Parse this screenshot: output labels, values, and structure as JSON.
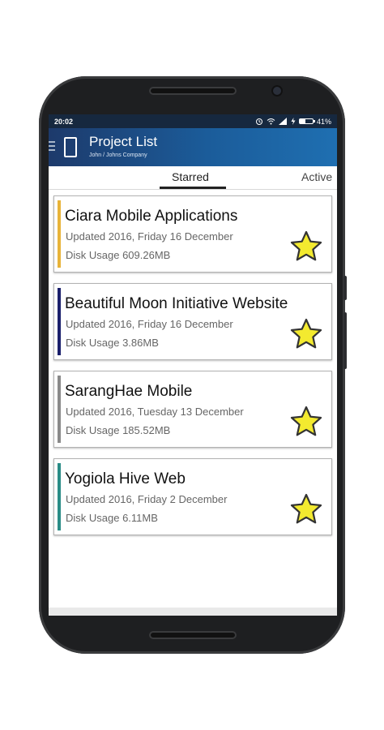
{
  "status_bar": {
    "time": "20:02",
    "battery": "41%"
  },
  "app_bar": {
    "title": "Project List",
    "subtitle": "John / Johns Company"
  },
  "tabs": [
    {
      "label": "Starred",
      "selected": true
    },
    {
      "label": "Active",
      "selected": false
    }
  ],
  "projects": [
    {
      "name": "Ciara Mobile Applications",
      "updated": "Updated 2016, Friday 16 December",
      "disk": "Disk Usage 609.26MB",
      "color": "#e8b339",
      "starred": true
    },
    {
      "name": "Beautiful Moon Initiative Website",
      "updated": "Updated 2016, Friday 16 December",
      "disk": "Disk Usage 3.86MB",
      "color": "#1a1f6b",
      "starred": true
    },
    {
      "name": "SarangHae Mobile",
      "updated": "Updated 2016, Tuesday 13 December",
      "disk": "Disk Usage 185.52MB",
      "color": "#8a8a8a",
      "starred": true
    },
    {
      "name": "Yogiola Hive Web",
      "updated": "Updated 2016, Friday 2 December",
      "disk": "Disk Usage 6.11MB",
      "color": "#2a8c86",
      "starred": true
    }
  ],
  "colors": {
    "star_fill": "#f3ea2f",
    "star_stroke": "#333333",
    "app_bar": "#1b5c9a",
    "status_bar": "#16283f"
  },
  "icons": {
    "menu": "hamburger-icon",
    "logo": "phone-icon",
    "star": "star-icon"
  }
}
